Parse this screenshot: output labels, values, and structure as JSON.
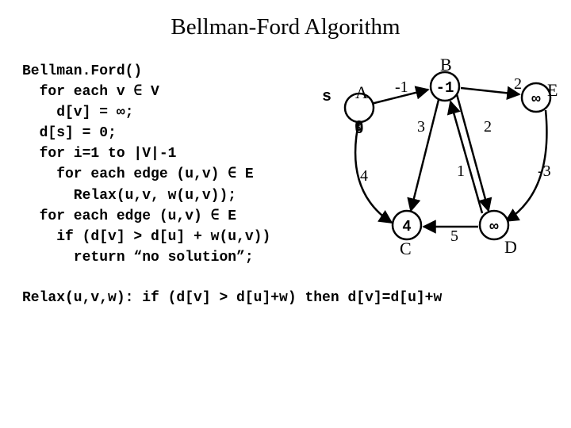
{
  "title": "Bellman-Ford Algorithm",
  "code": {
    "l1": "Bellman.Ford()",
    "l2": "  for each v ∈ V",
    "l3": "    d[v] = ∞;",
    "l4": "  d[s] = 0;",
    "l5": "  for i=1 to |V|-1",
    "l6": "    for each edge (u,v) ∈ E",
    "l7": "      Relax(u,v, w(u,v));",
    "l8": "  for each edge (u,v) ∈ E",
    "l9": "    if (d[v] > d[u] + w(u,v))",
    "l10": "      return “no solution”;"
  },
  "relax": "Relax(u,v,w): if (d[v] > d[u]+w) then d[v]=d[u]+w",
  "graph": {
    "source_label": "s",
    "nodes": {
      "A": {
        "label": "A",
        "value": "0"
      },
      "B": {
        "label": "B",
        "value": "-1"
      },
      "C": {
        "label": "C",
        "value": "4"
      },
      "D": {
        "label": "D",
        "value": "∞"
      },
      "E": {
        "label": "E",
        "value": "∞"
      }
    },
    "edges": {
      "AB": "-1",
      "AC": "4",
      "BC": "3",
      "BD": "2",
      "BE": "2",
      "DC": "5",
      "DB": "1",
      "ED": "-3"
    }
  }
}
